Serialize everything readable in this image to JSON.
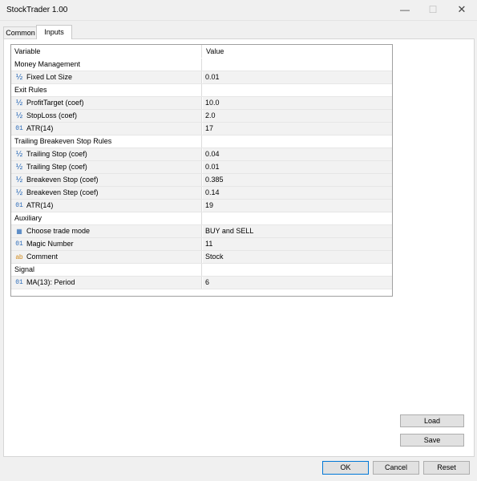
{
  "window": {
    "title": "StockTrader 1.00",
    "minimize": "—",
    "maximize": "☐",
    "close": "✕"
  },
  "tabs": [
    {
      "label": "Common"
    },
    {
      "label": "Inputs"
    }
  ],
  "grid": {
    "columns": {
      "variable": "Variable",
      "value": "Value"
    },
    "rows": [
      {
        "type": "group",
        "label": "Money Management",
        "value": ""
      },
      {
        "type": "param",
        "icon": "½",
        "label": "Fixed Lot Size",
        "value": "0.01"
      },
      {
        "type": "group",
        "label": "Exit Rules",
        "value": ""
      },
      {
        "type": "param",
        "icon": "½",
        "label": "ProfitTarget (coef)",
        "value": "10.0"
      },
      {
        "type": "param",
        "icon": "½",
        "label": "StopLoss (coef)",
        "value": "2.0"
      },
      {
        "type": "param",
        "icon": "01",
        "label": "ATR(14)",
        "value": "17"
      },
      {
        "type": "group",
        "label": "Trailing Breakeven Stop Rules",
        "value": ""
      },
      {
        "type": "param",
        "icon": "½",
        "label": "Trailing Stop (coef)",
        "value": "0.04"
      },
      {
        "type": "param",
        "icon": "½",
        "label": "Trailing Step (coef)",
        "value": "0.01"
      },
      {
        "type": "param",
        "icon": "½",
        "label": "Breakeven Stop (coef)",
        "value": "0.385"
      },
      {
        "type": "param",
        "icon": "½",
        "label": "Breakeven Step (coef)",
        "value": "0.14"
      },
      {
        "type": "param",
        "icon": "01",
        "label": "ATR(14)",
        "value": "19"
      },
      {
        "type": "group",
        "label": "Auxiliary",
        "value": ""
      },
      {
        "type": "param",
        "icon": "▦",
        "label": "Choose trade mode",
        "value": "BUY and SELL"
      },
      {
        "type": "param",
        "icon": "01",
        "label": "Magic Number",
        "value": "11"
      },
      {
        "type": "param",
        "icon": "ab",
        "label": "Comment",
        "value": "Stock"
      },
      {
        "type": "group",
        "label": "Signal",
        "value": ""
      },
      {
        "type": "param",
        "icon": "01",
        "label": "MA(13): Period",
        "value": "6"
      }
    ]
  },
  "buttons": {
    "load": "Load",
    "save": "Save",
    "ok": "OK",
    "cancel": "Cancel",
    "reset": "Reset"
  }
}
